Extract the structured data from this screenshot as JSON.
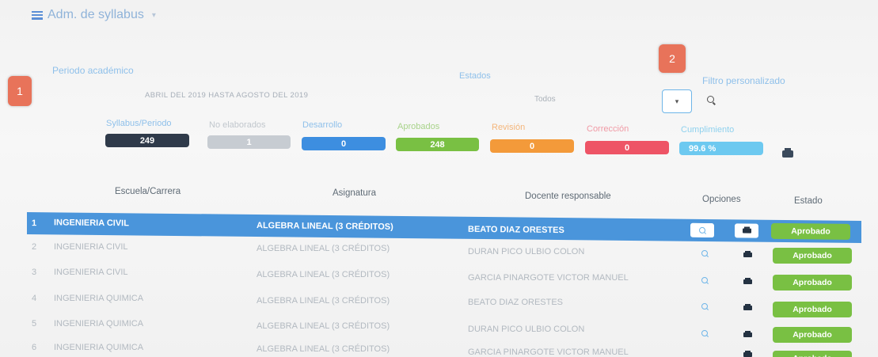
{
  "header": {
    "title": "Adm. de syllabus",
    "menu_icon": "list-menu-icon"
  },
  "markers": [
    "1",
    "2"
  ],
  "filters": {
    "period_label": "Periodo académico",
    "period_value": "ABRIL DEL 2019 HASTA AGOSTO DEL 2019",
    "estado_label": "Estados",
    "estado_value": "Todos",
    "custom_filter_label": "Filtro personalizado"
  },
  "stats": [
    {
      "label": "Syllabus/Periodo",
      "value": "249",
      "color": "#2f3a4a"
    },
    {
      "label": "No elaborados",
      "value": "1",
      "color": "#c7ccd2"
    },
    {
      "label": "Desarrollo",
      "value": "0",
      "color": "#3d8ee0"
    },
    {
      "label": "Aprobados",
      "value": "248",
      "color": "#79c043"
    },
    {
      "label": "Revisión",
      "value": "0",
      "color": "#f39a3a"
    },
    {
      "label": "Corrección",
      "value": "0",
      "color": "#ee5466"
    },
    {
      "label": "Cumplimiento",
      "value": "99.6 %",
      "color": "#6dc9f0"
    }
  ],
  "table": {
    "headers": [
      "Escuela/Carrera",
      "Asignatura",
      "Docente responsable",
      "Opciones",
      "Estado"
    ],
    "rows": [
      {
        "num": "1",
        "escuela": "INGENIERIA CIVIL",
        "asignatura": "ALGEBRA LINEAL (3 CRÉDITOS)",
        "docente": "BEATO DIAZ ORESTES",
        "estado": "Aprobado"
      },
      {
        "num": "2",
        "escuela": "INGENIERIA CIVIL",
        "asignatura": "ALGEBRA LINEAL (3 CRÉDITOS)",
        "docente": "DURAN PICO ULBIO COLON",
        "estado": "Aprobado"
      },
      {
        "num": "3",
        "escuela": "INGENIERIA CIVIL",
        "asignatura": "ALGEBRA LINEAL (3 CRÉDITOS)",
        "docente": "GARCIA PINARGOTE VICTOR MANUEL",
        "estado": "Aprobado"
      },
      {
        "num": "4",
        "escuela": "INGENIERIA QUIMICA",
        "asignatura": "ALGEBRA LINEAL (3 CRÉDITOS)",
        "docente": "BEATO DIAZ ORESTES",
        "estado": "Aprobado"
      },
      {
        "num": "5",
        "escuela": "INGENIERIA QUIMICA",
        "asignatura": "ALGEBRA LINEAL (3 CRÉDITOS)",
        "docente": "DURAN PICO ULBIO COLON",
        "estado": "Aprobado"
      },
      {
        "num": "6",
        "escuela": "INGENIERIA QUIMICA",
        "asignatura": "ALGEBRA LINEAL (3 CRÉDITOS)",
        "docente": "GARCIA PINARGOTE VICTOR MANUEL",
        "estado": "Aprobado"
      }
    ]
  }
}
